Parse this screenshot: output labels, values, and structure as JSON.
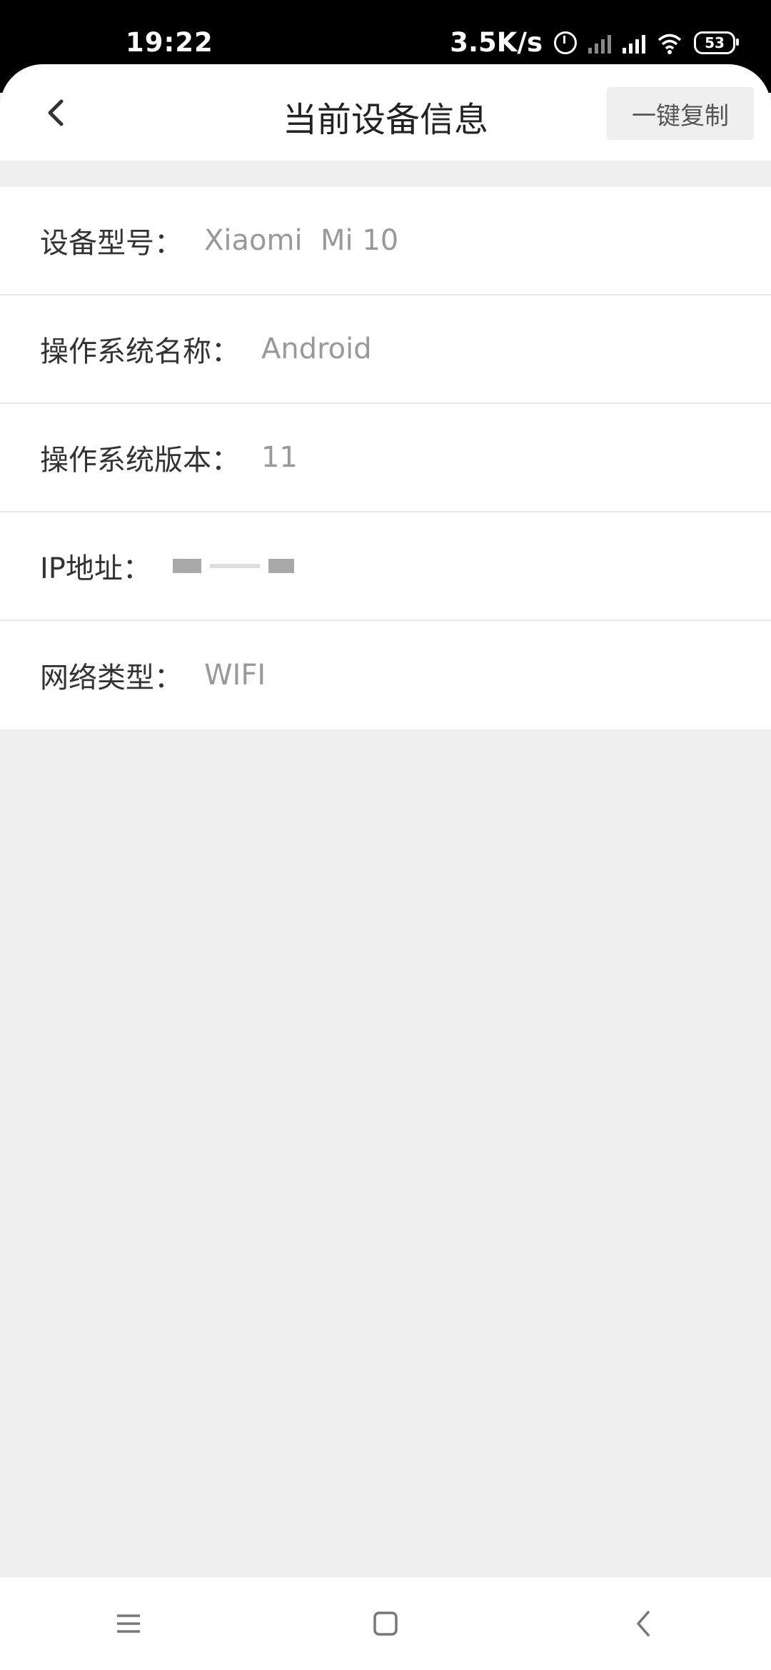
{
  "status_bar": {
    "time": "19:22",
    "net_speed": "3.5K/s",
    "battery": "53"
  },
  "header": {
    "title": "当前设备信息",
    "copy_button": "一键复制"
  },
  "device_info": [
    {
      "label": "设备型号：",
      "value": "Xiaomi  Mi 10"
    },
    {
      "label": "操作系统名称：",
      "value": "Android"
    },
    {
      "label": "操作系统版本：",
      "value": "11"
    },
    {
      "label": "IP地址：",
      "value": ""
    },
    {
      "label": "网络类型：",
      "value": "WIFI"
    }
  ],
  "icons": {
    "back": "chevron-left-icon",
    "nav_menu": "menu-icon",
    "nav_home": "home-square-icon",
    "nav_back": "back-chevron-icon"
  }
}
